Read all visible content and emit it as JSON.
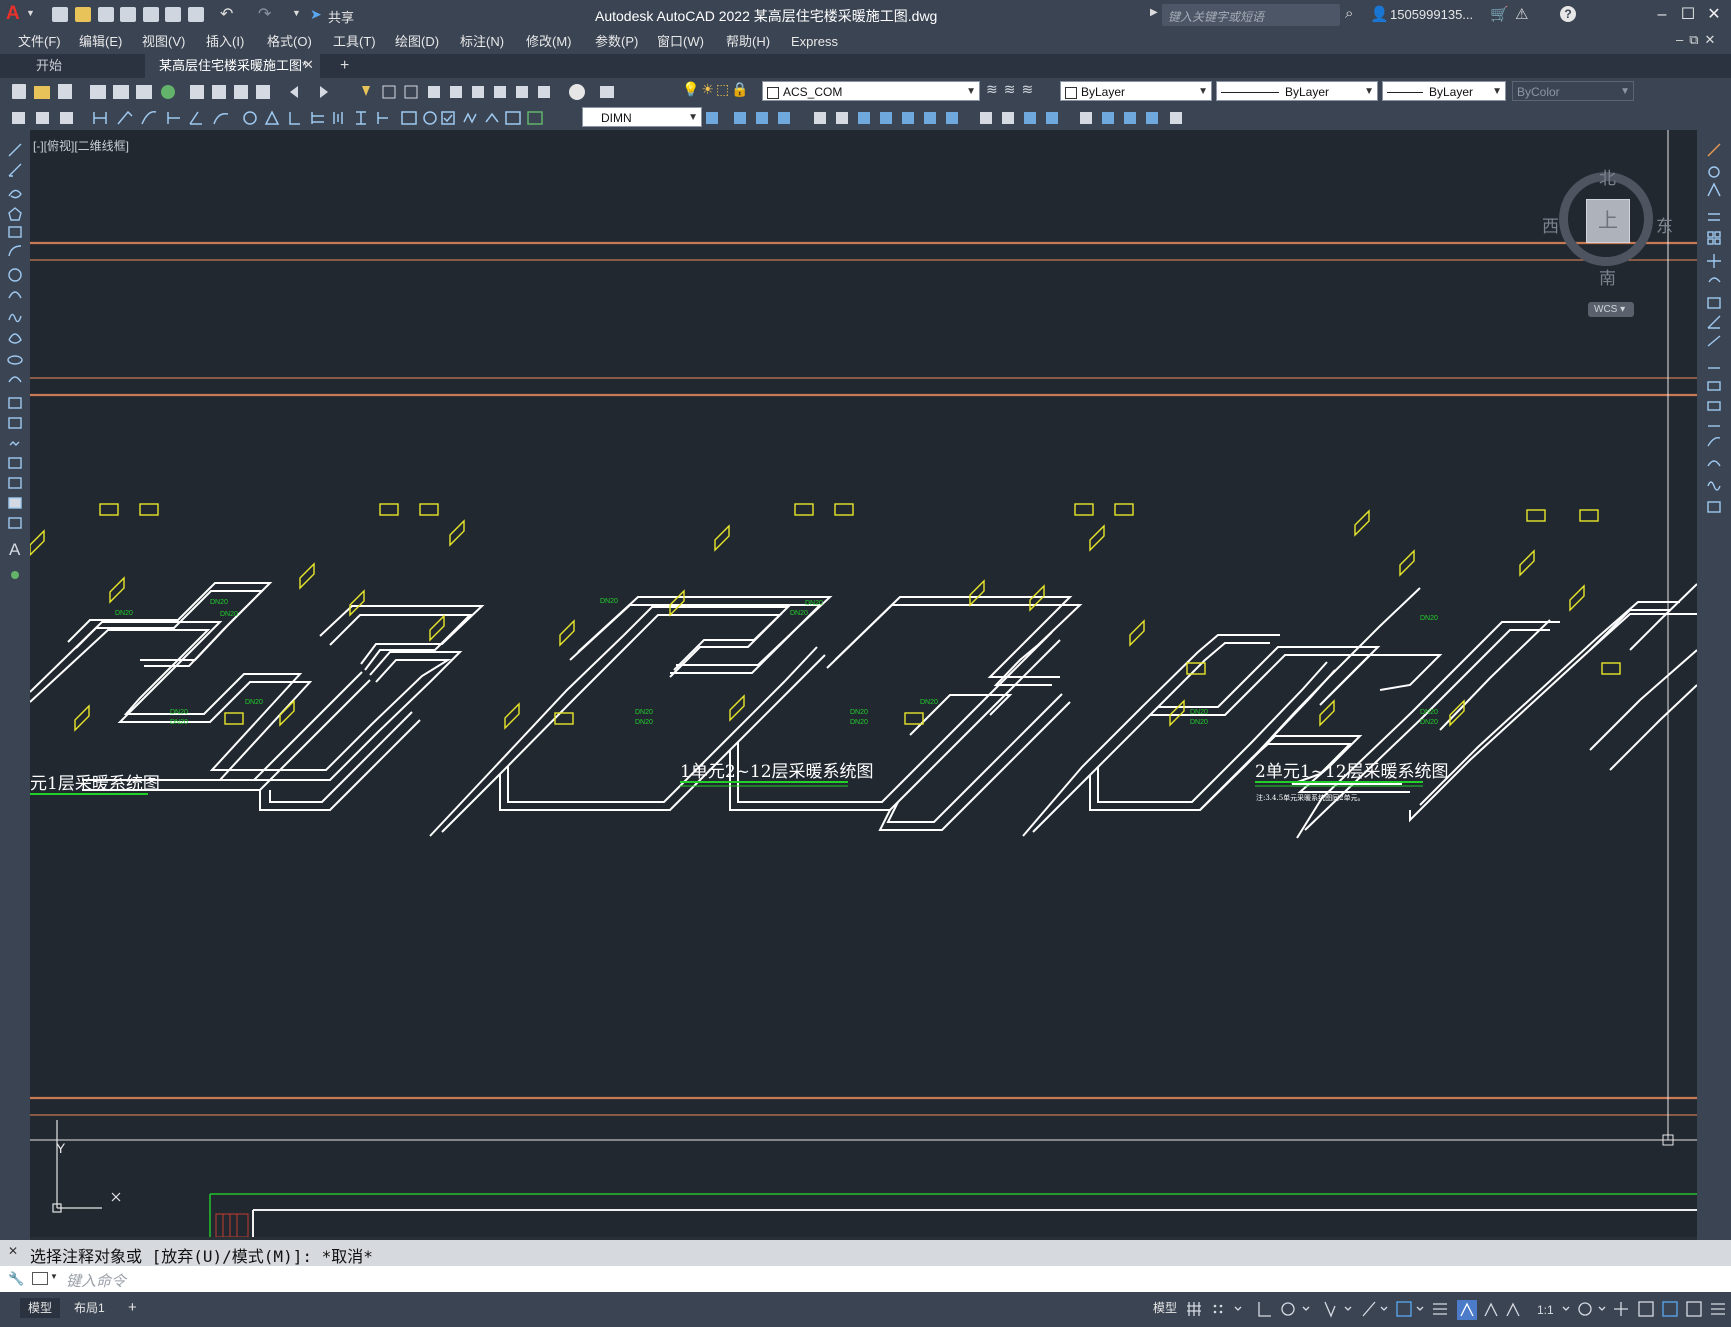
{
  "app": {
    "title": "Autodesk AutoCAD 2022    某高层住宅楼采暖施工图.dwg",
    "search_placeholder": "键入关键字或短语",
    "user": "1505999135...",
    "share": "共享",
    "accent": "#d9231c"
  },
  "menu": [
    "文件(F)",
    "编辑(E)",
    "视图(V)",
    "插入(I)",
    "格式(O)",
    "工具(T)",
    "绘图(D)",
    "标注(N)",
    "修改(M)",
    "参数(P)",
    "窗口(W)",
    "帮助(H)",
    "Express"
  ],
  "tabs": {
    "start": "开始",
    "drawing": "某高层住宅楼采暖施工图*",
    "add": "+"
  },
  "toolbar": {
    "layer": "ACS_COM",
    "color": "ByLayer",
    "linetype": "ByLayer",
    "lineweight": "ByLayer",
    "plotstyle": "ByColor",
    "dimstyle": "DIMN"
  },
  "viewport": {
    "label": "[-][俯视][二维线框]"
  },
  "viewcube": {
    "north": "北",
    "south": "南",
    "east": "东",
    "west": "西",
    "top": "上",
    "wcs": "WCS"
  },
  "ucs": {
    "x": "X",
    "y": "Y"
  },
  "drawing": {
    "caption_left": "元1层采暖系统图",
    "caption_mid": "1单元2~12层采暖系统图",
    "caption_right": "2单元1~12层采暖系统图",
    "note_right": "注:3.4.5单元采暖系统图同2单元。",
    "pipe_label": "DN20"
  },
  "command": {
    "history": "选择注释对象或 [放弃(U)/模式(M)]: *取消*",
    "placeholder": "键入命令"
  },
  "status": {
    "model": "模型",
    "layout1": "布局1",
    "add": "+",
    "model_btn": "模型",
    "scale": "1:1"
  }
}
